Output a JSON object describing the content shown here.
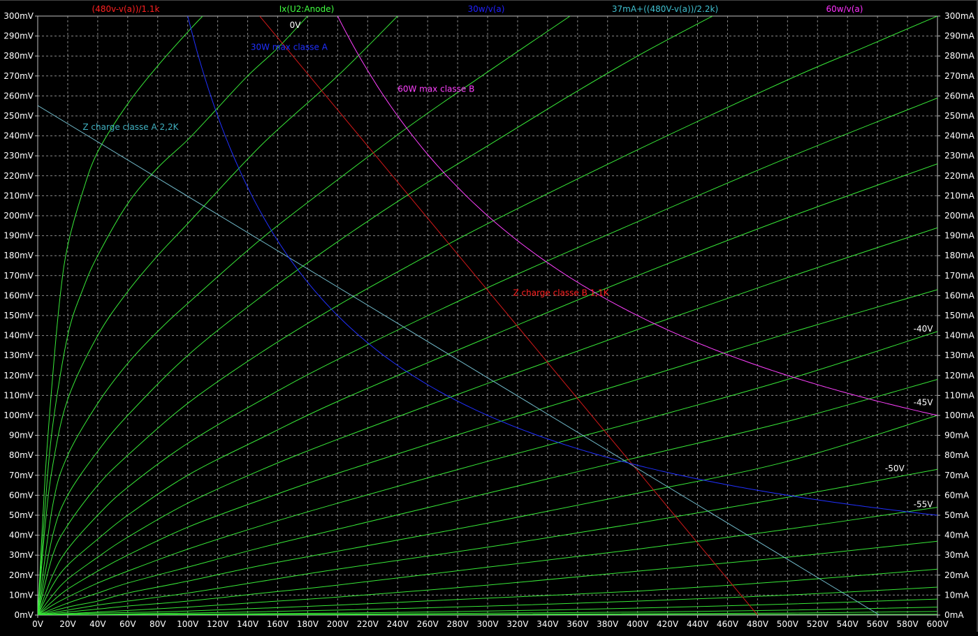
{
  "chart_data": {
    "type": "line",
    "title": "",
    "xlabel": "",
    "ylabel_left": "",
    "ylabel_right": "",
    "xlim": [
      0,
      600
    ],
    "ylim_left": [
      0,
      300
    ],
    "ylim_right": [
      0,
      300
    ],
    "x_unit": "V",
    "left_unit": "mV",
    "right_unit": "mA",
    "grid": true,
    "x_ticks": [
      "0V",
      "20V",
      "40V",
      "60V",
      "80V",
      "100V",
      "120V",
      "140V",
      "160V",
      "180V",
      "200V",
      "220V",
      "240V",
      "260V",
      "280V",
      "300V",
      "320V",
      "340V",
      "360V",
      "380V",
      "400V",
      "420V",
      "440V",
      "460V",
      "480V",
      "500V",
      "520V",
      "540V",
      "560V",
      "580V",
      "600V"
    ],
    "y_left_ticks": [
      "0mV",
      "10mV",
      "20mV",
      "30mV",
      "40mV",
      "50mV",
      "60mV",
      "70mV",
      "80mV",
      "90mV",
      "100mV",
      "110mV",
      "120mV",
      "130mV",
      "140mV",
      "150mV",
      "160mV",
      "170mV",
      "180mV",
      "190mV",
      "200mV",
      "210mV",
      "220mV",
      "230mV",
      "240mV",
      "250mV",
      "260mV",
      "270mV",
      "280mV",
      "290mV",
      "300mV"
    ],
    "y_right_ticks": [
      "0mA",
      "10mA",
      "20mA",
      "30mA",
      "40mA",
      "50mA",
      "60mA",
      "70mA",
      "80mA",
      "90mA",
      "100mA",
      "110mA",
      "120mA",
      "130mA",
      "140mA",
      "150mA",
      "160mA",
      "170mA",
      "180mA",
      "190mA",
      "200mA",
      "210mA",
      "220mA",
      "230mA",
      "240mA",
      "250mA",
      "260mA",
      "270mA",
      "280mA",
      "290mA",
      "300mA"
    ],
    "legend": [
      {
        "label": "(480v-v(a))/1.1k",
        "color": "#ff2020"
      },
      {
        "label": "Ix(U2:Anode)",
        "color": "#40ff40"
      },
      {
        "label": "30w/v(a)",
        "color": "#2020ff"
      },
      {
        "label": "37mA+((480V-v(a))/2.2k)",
        "color": "#40c0d0"
      },
      {
        "label": "60w/v(a)",
        "color": "#ff30ff"
      }
    ],
    "series": [
      {
        "name": "(480v-v(a))/1.1k",
        "kind": "linear",
        "color": "#d01818",
        "x": [
          148,
          480
        ],
        "y": [
          300,
          0
        ]
      },
      {
        "name": "37mA+((480V-v(a))/2.2k)",
        "kind": "linear",
        "color": "#70b8c8",
        "x": [
          0,
          561.4
        ],
        "y": [
          255.2,
          0
        ]
      },
      {
        "name": "30w/v(a)",
        "kind": "hyperbola",
        "color": "#2030ff",
        "power_w": 30,
        "x_range": [
          100,
          600
        ]
      },
      {
        "name": "60w/v(a)",
        "kind": "hyperbola",
        "color": "#ff40ff",
        "power_w": 60,
        "x_range": [
          200,
          600
        ]
      }
    ],
    "anode_curves": {
      "name": "Ix(U2:Anode)",
      "color": "#38e838",
      "curves": [
        {
          "grid_v": 0,
          "points": [
            [
              0,
              0
            ],
            [
              5,
              70
            ],
            [
              10,
              120
            ],
            [
              15,
              160
            ],
            [
              20,
              185
            ],
            [
              30,
              212
            ],
            [
              40,
              232
            ],
            [
              60,
              256
            ],
            [
              80,
              275
            ],
            [
              100,
              292
            ],
            [
              110,
              300
            ]
          ]
        },
        {
          "points": [
            [
              0,
              0
            ],
            [
              5,
              55
            ],
            [
              10,
              95
            ],
            [
              20,
              140
            ],
            [
              30,
              163
            ],
            [
              40,
              180
            ],
            [
              60,
              206
            ],
            [
              80,
              224
            ],
            [
              100,
              238
            ],
            [
              120,
              254
            ],
            [
              140,
              270
            ],
            [
              160,
              284
            ],
            [
              180,
              300
            ]
          ]
        },
        {
          "points": [
            [
              0,
              0
            ],
            [
              5,
              45
            ],
            [
              10,
              75
            ],
            [
              20,
              108
            ],
            [
              40,
              140
            ],
            [
              60,
              162
            ],
            [
              80,
              180
            ],
            [
              100,
              196
            ],
            [
              150,
              236
            ],
            [
              200,
              270
            ],
            [
              240,
              300
            ]
          ]
        },
        {
          "points": [
            [
              0,
              0
            ],
            [
              10,
              55
            ],
            [
              20,
              80
            ],
            [
              40,
              106
            ],
            [
              60,
              126
            ],
            [
              80,
              142
            ],
            [
              100,
              156
            ],
            [
              150,
              189
            ],
            [
              200,
              218
            ],
            [
              250,
              246
            ],
            [
              300,
              272
            ],
            [
              355,
              300
            ]
          ]
        },
        {
          "points": [
            [
              0,
              0
            ],
            [
              10,
              40
            ],
            [
              20,
              60
            ],
            [
              40,
              82
            ],
            [
              60,
              100
            ],
            [
              100,
              130
            ],
            [
              150,
              160
            ],
            [
              200,
              187
            ],
            [
              250,
              212
            ],
            [
              300,
              235
            ],
            [
              350,
              258
            ],
            [
              400,
              280
            ],
            [
              450,
              300
            ]
          ]
        },
        {
          "points": [
            [
              0,
              0
            ],
            [
              10,
              30
            ],
            [
              20,
              45
            ],
            [
              40,
              65
            ],
            [
              60,
              80
            ],
            [
              100,
              106
            ],
            [
              150,
              132
            ],
            [
              200,
              155
            ],
            [
              250,
              176
            ],
            [
              300,
              196
            ],
            [
              400,
              233
            ],
            [
              500,
              268
            ],
            [
              550,
              284
            ],
            [
              600,
              300
            ]
          ]
        },
        {
          "points": [
            [
              0,
              0
            ],
            [
              10,
              20
            ],
            [
              20,
              33
            ],
            [
              40,
              50
            ],
            [
              60,
              64
            ],
            [
              100,
              86
            ],
            [
              150,
              108
            ],
            [
              200,
              128
            ],
            [
              300,
              164
            ],
            [
              400,
              197
            ],
            [
              500,
              229
            ],
            [
              600,
              259
            ]
          ]
        },
        {
          "points": [
            [
              0,
              0
            ],
            [
              10,
              15
            ],
            [
              20,
              25
            ],
            [
              40,
              38
            ],
            [
              60,
              50
            ],
            [
              100,
              70
            ],
            [
              150,
              89
            ],
            [
              200,
              107
            ],
            [
              300,
              139
            ],
            [
              400,
              170
            ],
            [
              500,
              199
            ],
            [
              600,
              226
            ]
          ]
        },
        {
          "points": [
            [
              0,
              0
            ],
            [
              10,
              10
            ],
            [
              20,
              18
            ],
            [
              40,
              29
            ],
            [
              60,
              39
            ],
            [
              100,
              56
            ],
            [
              150,
              73
            ],
            [
              200,
              88
            ],
            [
              300,
              116
            ],
            [
              400,
              143
            ],
            [
              500,
              169
            ],
            [
              600,
              194
            ]
          ]
        },
        {
          "points": [
            [
              0,
              0
            ],
            [
              10,
              7
            ],
            [
              20,
              13
            ],
            [
              40,
              22
            ],
            [
              60,
              30
            ],
            [
              100,
              44
            ],
            [
              150,
              58
            ],
            [
              200,
              71
            ],
            [
              300,
              95
            ],
            [
              400,
              118
            ],
            [
              500,
              141
            ],
            [
              600,
              163
            ]
          ]
        },
        {
          "grid_v": -40,
          "points": [
            [
              0,
              0
            ],
            [
              10,
              5
            ],
            [
              20,
              9
            ],
            [
              40,
              16
            ],
            [
              60,
              22
            ],
            [
              100,
              33
            ],
            [
              150,
              45
            ],
            [
              200,
              56
            ],
            [
              300,
              77
            ],
            [
              400,
              97
            ],
            [
              500,
              118
            ],
            [
              600,
              142
            ]
          ]
        },
        {
          "points": [
            [
              0,
              0
            ],
            [
              20,
              6
            ],
            [
              40,
              11
            ],
            [
              60,
              16
            ],
            [
              100,
              24
            ],
            [
              150,
              34
            ],
            [
              200,
              43
            ],
            [
              300,
              61
            ],
            [
              400,
              79
            ],
            [
              500,
              97
            ],
            [
              600,
              118
            ]
          ]
        },
        {
          "grid_v": -45,
          "points": [
            [
              0,
              0
            ],
            [
              20,
              4
            ],
            [
              40,
              7
            ],
            [
              60,
              11
            ],
            [
              100,
              17
            ],
            [
              150,
              25
            ],
            [
              200,
              32
            ],
            [
              300,
              46
            ],
            [
              400,
              61
            ],
            [
              500,
              77
            ],
            [
              600,
              100
            ]
          ]
        },
        {
          "points": [
            [
              0,
              0
            ],
            [
              20,
              2.5
            ],
            [
              40,
              5
            ],
            [
              60,
              7
            ],
            [
              100,
              11
            ],
            [
              150,
              17
            ],
            [
              200,
              23
            ],
            [
              300,
              34
            ],
            [
              400,
              46
            ],
            [
              500,
              59
            ],
            [
              600,
              73
            ]
          ]
        },
        {
          "grid_v": -50,
          "points": [
            [
              0,
              0
            ],
            [
              20,
              1.5
            ],
            [
              40,
              3
            ],
            [
              60,
              4.5
            ],
            [
              100,
              7
            ],
            [
              150,
              11
            ],
            [
              200,
              15
            ],
            [
              300,
              24
            ],
            [
              400,
              33
            ],
            [
              500,
              43
            ],
            [
              600,
              54
            ]
          ]
        },
        {
          "points": [
            [
              0,
              0
            ],
            [
              40,
              1.5
            ],
            [
              100,
              4
            ],
            [
              150,
              6.5
            ],
            [
              200,
              9
            ],
            [
              300,
              15
            ],
            [
              400,
              22
            ],
            [
              500,
              29
            ],
            [
              600,
              37
            ]
          ]
        },
        {
          "grid_v": -55,
          "points": [
            [
              0,
              0
            ],
            [
              40,
              1
            ],
            [
              100,
              2
            ],
            [
              200,
              5
            ],
            [
              300,
              8.5
            ],
            [
              400,
              12
            ],
            [
              500,
              17
            ],
            [
              600,
              23
            ]
          ]
        },
        {
          "points": [
            [
              0,
              0
            ],
            [
              100,
              1
            ],
            [
              200,
              2.5
            ],
            [
              300,
              4.5
            ],
            [
              400,
              7
            ],
            [
              500,
              10
            ],
            [
              600,
              14
            ]
          ]
        },
        {
          "points": [
            [
              0,
              0
            ],
            [
              100,
              0.5
            ],
            [
              200,
              1
            ],
            [
              300,
              2
            ],
            [
              400,
              3.5
            ],
            [
              500,
              5.5
            ],
            [
              600,
              8
            ]
          ]
        },
        {
          "points": [
            [
              0,
              0
            ],
            [
              200,
              0.5
            ],
            [
              400,
              1.5
            ],
            [
              500,
              2.5
            ],
            [
              600,
              4
            ]
          ]
        },
        {
          "points": [
            [
              0,
              0
            ],
            [
              300,
              0.3
            ],
            [
              500,
              1
            ],
            [
              600,
              1.8
            ]
          ]
        },
        {
          "points": [
            [
              0,
              0
            ],
            [
              600,
              0.4
            ]
          ]
        }
      ]
    },
    "annotations": [
      {
        "text": "30W max classe A",
        "color": "#2030ff",
        "x": 142,
        "y": 283
      },
      {
        "text": "60W max classe B",
        "color": "#ff40ff",
        "x": 240,
        "y": 262
      },
      {
        "text": "Z charge classe A 2,2K",
        "color": "#40b0c0",
        "x": 30,
        "y": 243
      },
      {
        "text": "Z charge classe B 1,1K",
        "color": "#ff2020",
        "x": 317,
        "y": 160
      },
      {
        "text": "0V",
        "color": "#ffffff",
        "x": 168,
        "y": 294
      },
      {
        "text": "-40V",
        "color": "#ffffff",
        "x": 584,
        "y": 142
      },
      {
        "text": "-45V",
        "color": "#ffffff",
        "x": 584,
        "y": 105
      },
      {
        "text": "-50V",
        "color": "#ffffff",
        "x": 565,
        "y": 72
      },
      {
        "text": "-55V",
        "color": "#ffffff",
        "x": 584,
        "y": 54
      }
    ]
  }
}
